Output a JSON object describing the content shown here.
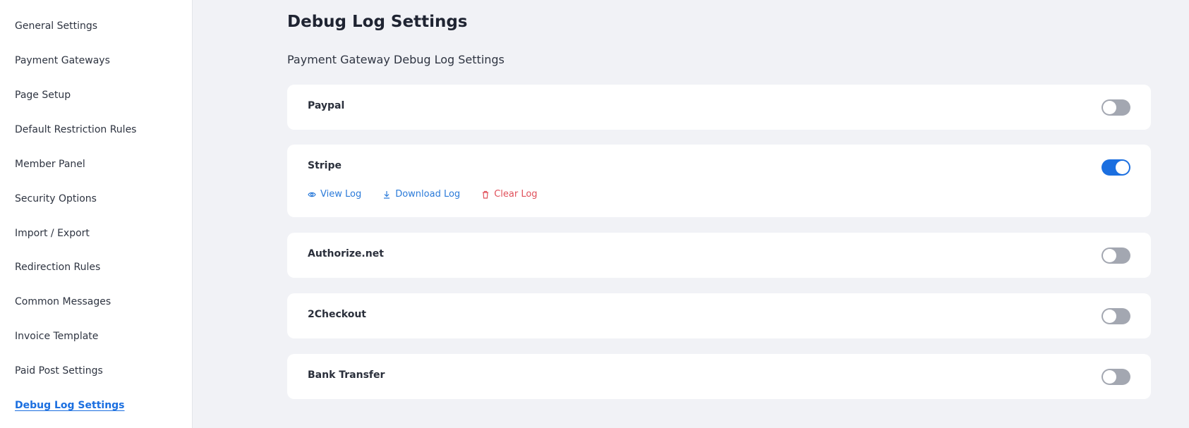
{
  "sidebar": {
    "items": [
      {
        "label": "General Settings"
      },
      {
        "label": "Payment Gateways"
      },
      {
        "label": "Page Setup"
      },
      {
        "label": "Default Restriction Rules"
      },
      {
        "label": "Member Panel"
      },
      {
        "label": "Security Options"
      },
      {
        "label": "Import / Export"
      },
      {
        "label": "Redirection Rules"
      },
      {
        "label": "Common Messages"
      },
      {
        "label": "Invoice Template"
      },
      {
        "label": "Paid Post Settings"
      },
      {
        "label": "Debug Log Settings",
        "active": true
      }
    ]
  },
  "main": {
    "title": "Debug Log Settings",
    "section_title": "Payment Gateway Debug Log Settings",
    "gateways": [
      {
        "name": "Paypal",
        "enabled": false
      },
      {
        "name": "Stripe",
        "enabled": true
      },
      {
        "name": "Authorize.net",
        "enabled": false
      },
      {
        "name": "2Checkout",
        "enabled": false
      },
      {
        "name": "Bank Transfer",
        "enabled": false
      }
    ],
    "log_actions": {
      "view": {
        "label": "View Log",
        "icon": "eye-icon"
      },
      "download": {
        "label": "Download Log",
        "icon": "download-icon"
      },
      "clear": {
        "label": "Clear Log",
        "icon": "trash-icon"
      }
    }
  },
  "colors": {
    "accent": "#1b6fe0",
    "danger": "#e0505a",
    "toggle_off": "#a3a7b1",
    "background": "#f1f2f6"
  }
}
